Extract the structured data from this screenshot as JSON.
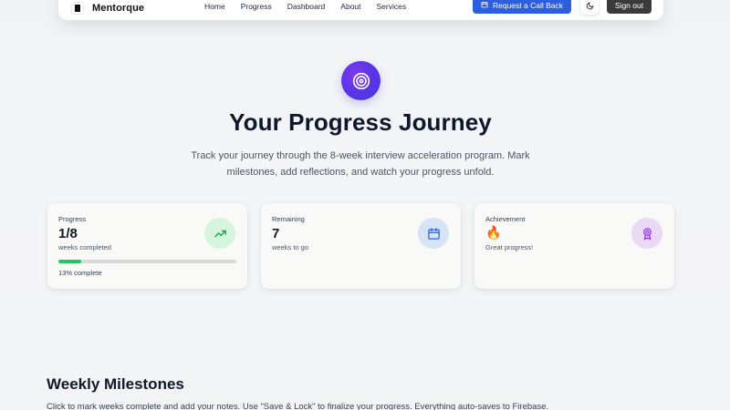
{
  "navbar": {
    "brand": "Mentorque",
    "links": [
      "Home",
      "Progress",
      "Dashboard",
      "About",
      "Services"
    ],
    "callback_label": "Request a Call Back",
    "signout_label": "Sign out"
  },
  "hero": {
    "title": "Your Progress Journey",
    "subtitle": "Track your journey through the 8-week interview acceleration program. Mark milestones, add reflections, and watch your progress unfold."
  },
  "stats": {
    "progress": {
      "label": "Progress",
      "value": "1/8",
      "sub": "weeks completed",
      "percent_text": "13% complete",
      "percent": 13,
      "icon": "trending-up-icon"
    },
    "remaining": {
      "label": "Remaining",
      "value": "7",
      "sub": "weeks to go",
      "icon": "calendar-icon"
    },
    "achievement": {
      "label": "Achievement",
      "emoji": "🔥",
      "sub": "Great progress!",
      "icon": "award-icon"
    }
  },
  "milestones": {
    "title": "Weekly Milestones",
    "subtitle": "Click to mark weeks complete and add your notes. Use \"Save & Lock\" to finalize your progress. Everything auto-saves to Firebase."
  },
  "colors": {
    "accent_blue": "#2b5fe0",
    "progress_green": "#22c55e",
    "hero_purple": "#5b34e6"
  }
}
